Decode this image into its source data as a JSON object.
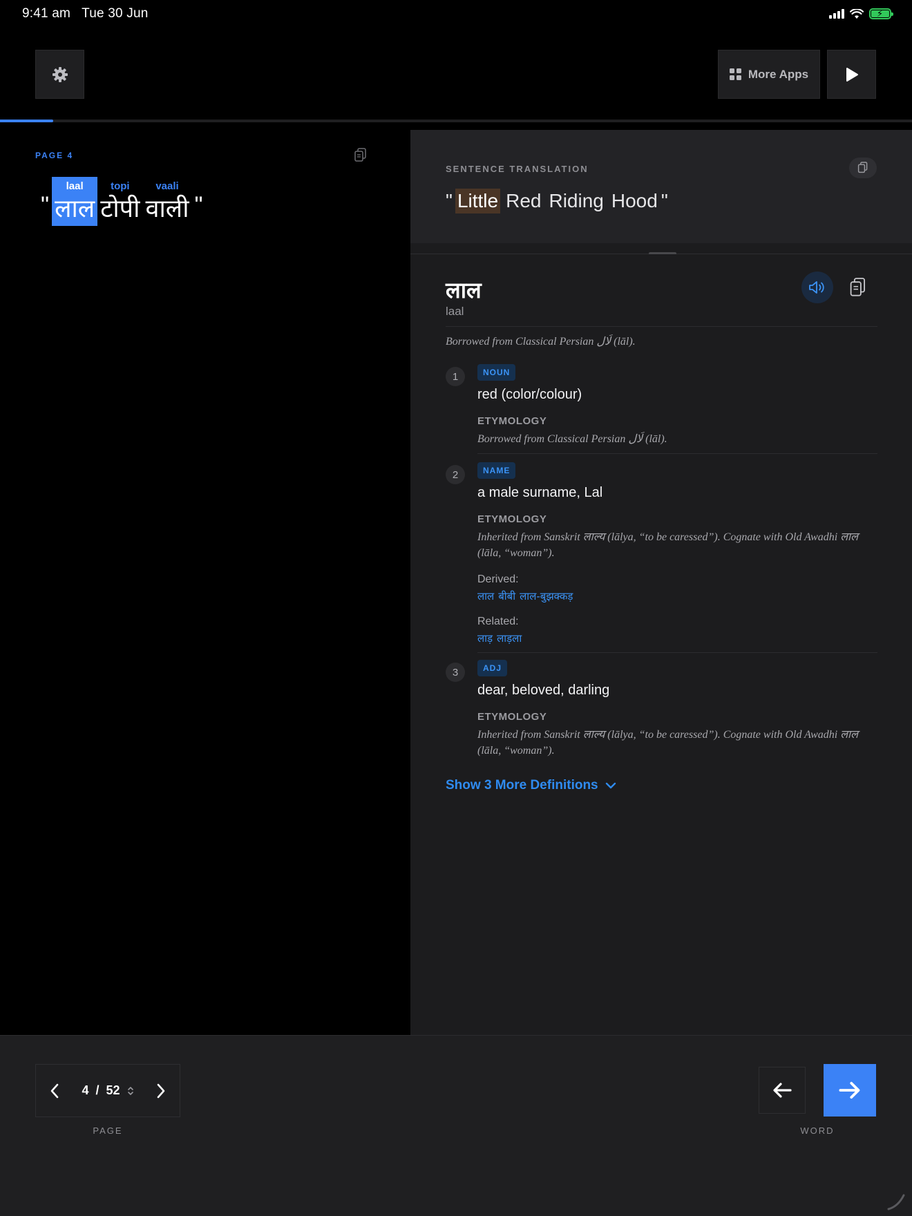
{
  "status": {
    "time": "9:41 am",
    "date": "Tue 30 Jun"
  },
  "toolbar": {
    "more_apps_label": "More Apps",
    "progress_fraction": 0.058
  },
  "source": {
    "page_label": "PAGE 4",
    "open_quote": "\"",
    "close_quote": "\"",
    "words": [
      {
        "translit": "laal",
        "hindi": "लाल",
        "active": true
      },
      {
        "translit": "topi",
        "hindi": "टोपी",
        "active": false
      },
      {
        "translit": "vaali",
        "hindi": "वाली",
        "active": false
      }
    ]
  },
  "translation": {
    "label": "SENTENCE TRANSLATION",
    "open_quote": "\"",
    "close_quote": "\"",
    "words": [
      {
        "text": "Little",
        "highlight": true
      },
      {
        "text": "Red",
        "highlight": false
      },
      {
        "text": "Riding",
        "highlight": false
      },
      {
        "text": "Hood",
        "highlight": false
      }
    ]
  },
  "dictionary": {
    "headword": "लाल",
    "transliteration": "laal",
    "etymology": "Borrowed from Classical Persian لَال (lāl).",
    "definitions": [
      {
        "number": "1",
        "pos": "NOUN",
        "text": "red (color/colour)",
        "etymology_label": "ETYMOLOGY",
        "etymology": "Borrowed from Classical Persian لَال (lāl)."
      },
      {
        "number": "2",
        "pos": "NAME",
        "text": "a male surname, Lal",
        "etymology_label": "ETYMOLOGY",
        "etymology": "Inherited from Sanskrit लाल्य (lālya, “to be caressed”). Cognate with Old Awadhi लाल (lāla, “woman”).",
        "derived_label": "Derived:",
        "derived": [
          "लाल",
          "बीबी",
          "लाल-बुझक्कड़"
        ],
        "related_label": "Related:",
        "related": [
          "लाड़",
          "लाड़ला"
        ]
      },
      {
        "number": "3",
        "pos": "ADJ",
        "text": "dear, beloved, darling",
        "etymology_label": "ETYMOLOGY",
        "etymology": "Inherited from Sanskrit लाल्य (lālya, “to be caressed”). Cognate with Old Awadhi लाल (lāla, “woman”)."
      }
    ],
    "show_more_label": "Show 3 More Definitions"
  },
  "footer": {
    "current_page": "4",
    "separator": "/",
    "total_pages": "52",
    "page_caption": "PAGE",
    "word_caption": "WORD"
  },
  "colors": {
    "accent": "#3b82f6",
    "link": "#3b93f6",
    "highlight": "#4a3526",
    "battery": "#32c85a"
  },
  "icons": [
    "gear-icon",
    "grid-icon",
    "play-icon",
    "copy-icon",
    "speaker-icon",
    "chevron-down-icon",
    "chevron-left-icon",
    "chevron-right-icon",
    "sort-icon",
    "arrow-left-icon",
    "arrow-right-icon"
  ]
}
